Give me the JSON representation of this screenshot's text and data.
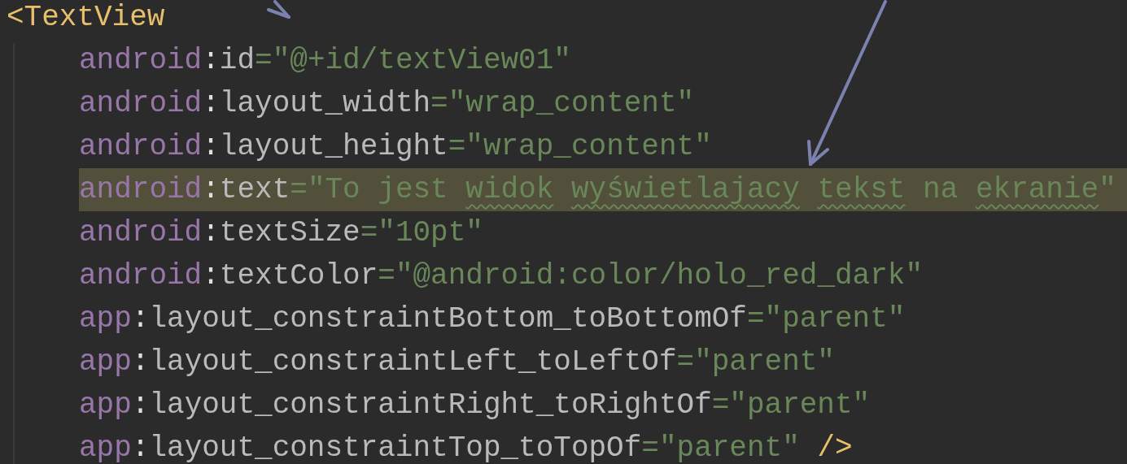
{
  "tag_open": "<TextView",
  "attributes": [
    {
      "namespace": "android",
      "separator": ":",
      "name": "id",
      "assign": "=",
      "value": "\"@+id/textView01\"",
      "highlighted": false
    },
    {
      "namespace": "android",
      "separator": ":",
      "name": "layout_width",
      "assign": "=",
      "value": "\"wrap_content\"",
      "highlighted": false
    },
    {
      "namespace": "android",
      "separator": ":",
      "name": "layout_height",
      "assign": "=",
      "value": "\"wrap_content\"",
      "highlighted": false
    },
    {
      "namespace": "android",
      "separator": ":",
      "name": "text",
      "assign": "=",
      "quote_open": "\"",
      "words": [
        {
          "text": "To",
          "misspelled": false
        },
        {
          "text": "jest",
          "misspelled": false
        },
        {
          "text": "widok",
          "misspelled": true
        },
        {
          "text": "wyświetlajacy",
          "misspelled": true
        },
        {
          "text": "tekst",
          "misspelled": true
        },
        {
          "text": "na",
          "misspelled": false
        },
        {
          "text": "ekranie",
          "misspelled": true
        }
      ],
      "quote_close": "\"",
      "highlighted": true
    },
    {
      "namespace": "android",
      "separator": ":",
      "name": "textSize",
      "assign": "=",
      "value": "\"10pt\"",
      "highlighted": false
    },
    {
      "namespace": "android",
      "separator": ":",
      "name": "textColor",
      "assign": "=",
      "value": "\"@android:color/holo_red_dark\"",
      "highlighted": false
    },
    {
      "namespace": "app",
      "separator": ":",
      "name": "layout_constraintBottom_toBottomOf",
      "assign": "=",
      "value": "\"parent\"",
      "highlighted": false
    },
    {
      "namespace": "app",
      "separator": ":",
      "name": "layout_constraintLeft_toLeftOf",
      "assign": "=",
      "value": "\"parent\"",
      "highlighted": false
    },
    {
      "namespace": "app",
      "separator": ":",
      "name": "layout_constraintRight_toRightOf",
      "assign": "=",
      "value": "\"parent\"",
      "highlighted": false
    },
    {
      "namespace": "app",
      "separator": ":",
      "name": "layout_constraintTop_toTopOf",
      "assign": "=",
      "value": "\"parent\"",
      "highlighted": false
    }
  ],
  "tag_close": "/>"
}
